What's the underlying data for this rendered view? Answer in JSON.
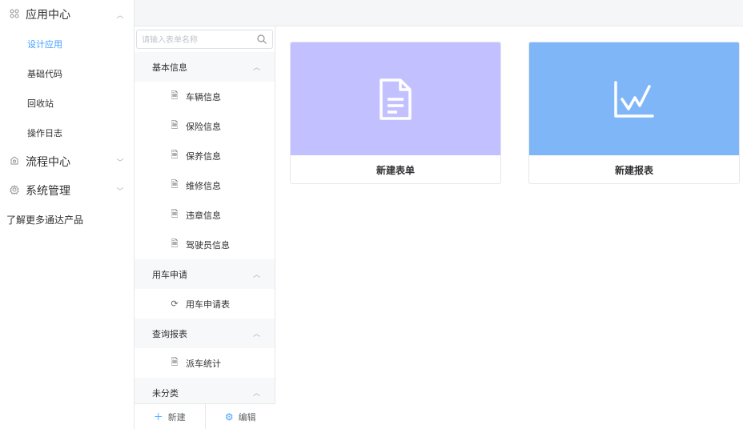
{
  "sidebar": {
    "app_center": {
      "label": "应用中心",
      "icon": "app-grid-icon",
      "items": [
        {
          "label": "设计应用",
          "active": true
        },
        {
          "label": "基础代码",
          "active": false
        },
        {
          "label": "回收站",
          "active": false
        },
        {
          "label": "操作日志",
          "active": false
        }
      ]
    },
    "process_center": {
      "label": "流程中心",
      "icon": "process-icon"
    },
    "system_mgmt": {
      "label": "系统管理",
      "icon": "gear-icon"
    },
    "more_label": "了解更多通达产品"
  },
  "tree": {
    "search_placeholder": "请输入表单名称",
    "categories": [
      {
        "label": "基本信息",
        "items": [
          "车辆信息",
          "保险信息",
          "保养信息",
          "维修信息",
          "违章信息",
          "驾驶员信息"
        ]
      },
      {
        "label": "用车申请",
        "items": [
          "用车申请表"
        ]
      },
      {
        "label": "查询报表",
        "items": [
          "派车统计"
        ]
      },
      {
        "label": "未分类",
        "items": []
      }
    ],
    "new_label": "新建",
    "edit_label": "编辑"
  },
  "cards": [
    {
      "title": "新建表单",
      "icon": "document-icon",
      "color": "#c2c0ff"
    },
    {
      "title": "新建报表",
      "icon": "line-chart-icon",
      "color": "#7fb6f7"
    }
  ],
  "colors": {
    "accent": "#409eff"
  }
}
